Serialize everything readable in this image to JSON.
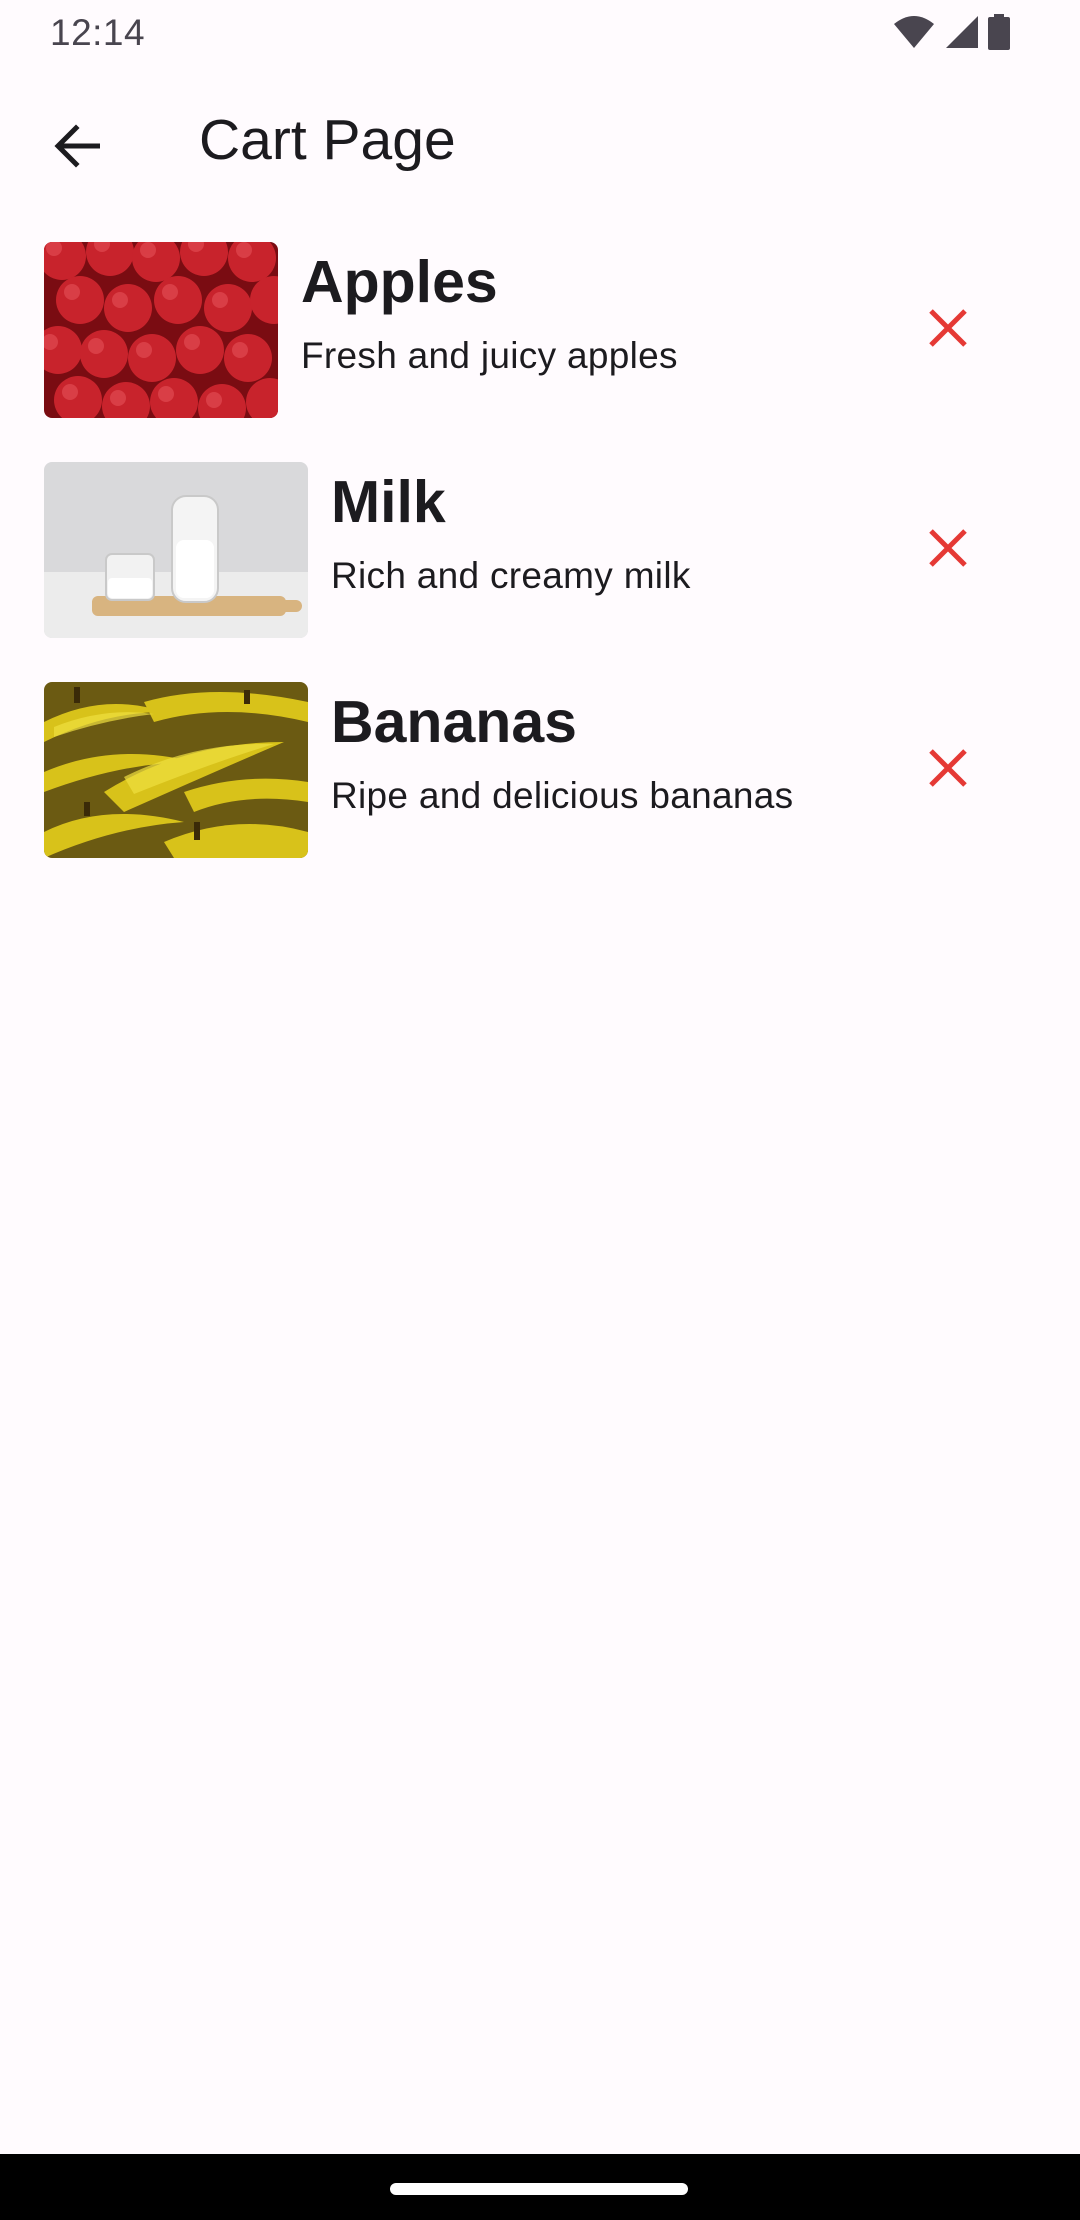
{
  "status_bar": {
    "time": "12:14",
    "icons": [
      "wifi-icon",
      "cellular-signal-icon",
      "battery-icon"
    ]
  },
  "app_bar": {
    "back_icon": "arrow-back-icon",
    "title": "Cart Page"
  },
  "cart": {
    "items": [
      {
        "name": "Apples",
        "description": "Fresh and juicy apples",
        "image": "apples-image",
        "remove_icon": "close-icon"
      },
      {
        "name": "Milk",
        "description": "Rich and creamy milk",
        "image": "milk-image",
        "remove_icon": "close-icon"
      },
      {
        "name": "Bananas",
        "description": "Ripe and delicious bananas",
        "image": "bananas-image",
        "remove_icon": "close-icon"
      }
    ]
  },
  "colors": {
    "background": "#fffbfe",
    "remove_accent": "#e53935",
    "nav_bar": "#000000"
  }
}
